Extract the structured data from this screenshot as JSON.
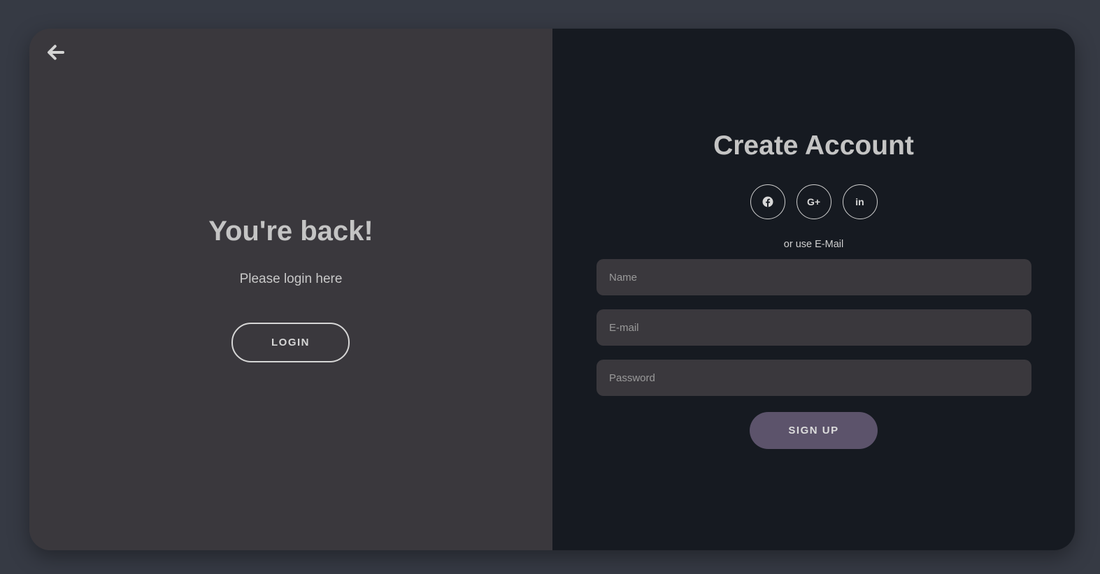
{
  "welcome": {
    "title": "You're back!",
    "subtitle": "Please login here",
    "login_label": "LOGIN",
    "back_icon": "arrow-left-icon"
  },
  "signup": {
    "title": "Create Account",
    "socials": [
      {
        "icon": "facebook-icon",
        "glyph": "f"
      },
      {
        "icon": "google-plus-icon",
        "glyph": "G+"
      },
      {
        "icon": "linkedin-icon",
        "glyph": "in"
      }
    ],
    "or_text": "or use E-Mail",
    "name_placeholder": "Name",
    "email_placeholder": "E-mail",
    "password_placeholder": "Password",
    "signup_label": "SIGN UP"
  },
  "colors": {
    "page_bg": "#363a44",
    "left_panel": "#3a383d",
    "right_panel": "#161a21",
    "accent": "#5c536b"
  }
}
